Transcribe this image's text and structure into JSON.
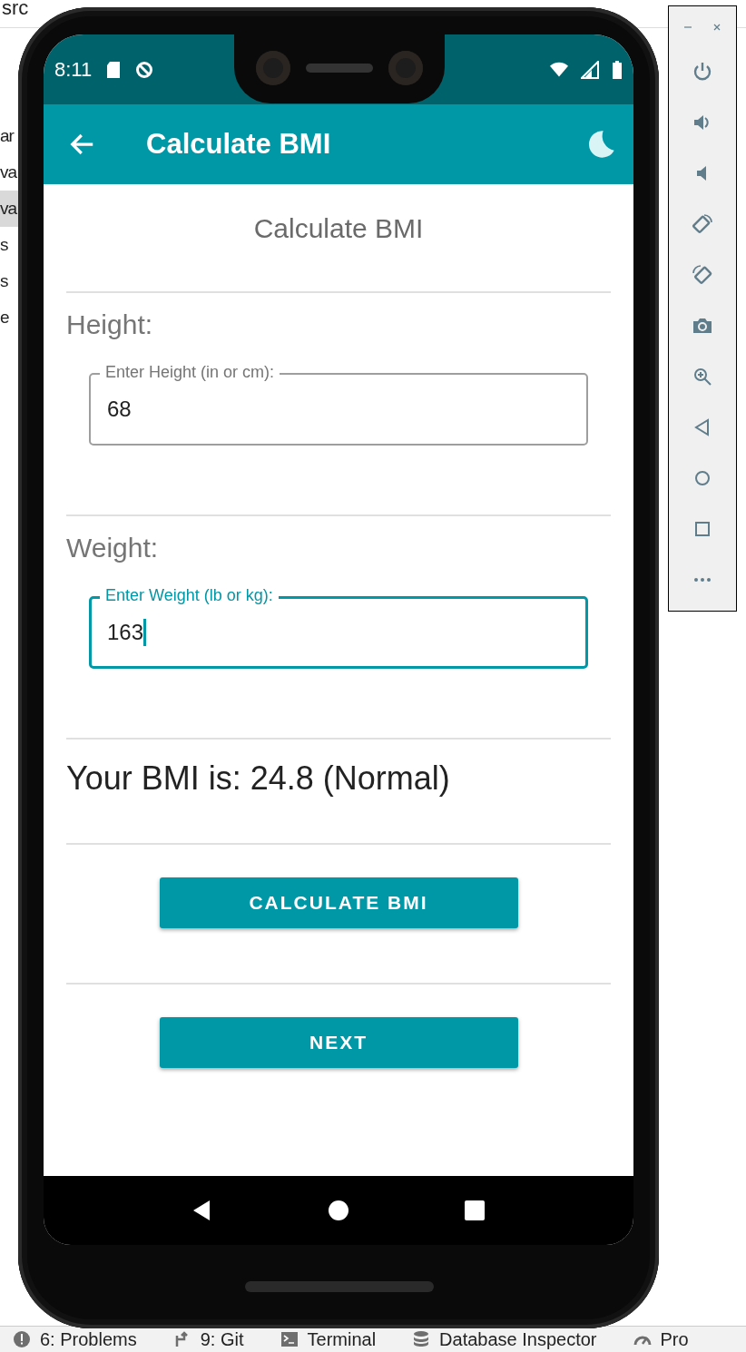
{
  "ide": {
    "breadcrumbs": [
      "src"
    ],
    "tree_fragments": [
      {
        "text": "ar",
        "selected": false
      },
      {
        "text": "va",
        "selected": false
      },
      {
        "text": "va",
        "selected": true
      },
      {
        "text": "s",
        "selected": false
      },
      {
        "text": "s",
        "selected": false
      },
      {
        "text": "e",
        "selected": false
      }
    ],
    "tool_tabs": [
      "6: Problems",
      "9: Git",
      "Terminal",
      "Database Inspector",
      "Pro"
    ]
  },
  "status_bar": {
    "time": "8:11"
  },
  "app_bar": {
    "title": "Calculate BMI"
  },
  "content": {
    "heading": "Calculate BMI",
    "sections": [
      {
        "label": "Height:",
        "field": {
          "floating_label": "Enter Height (in or cm):",
          "value": "68",
          "focused": false
        }
      },
      {
        "label": "Weight:",
        "field": {
          "floating_label": "Enter Weight (lb or kg):",
          "value": "163",
          "focused": true
        }
      }
    ],
    "result": "Your BMI is: 24.8 (Normal)",
    "buttons": [
      "CALCULATE BMI",
      "NEXT"
    ]
  }
}
